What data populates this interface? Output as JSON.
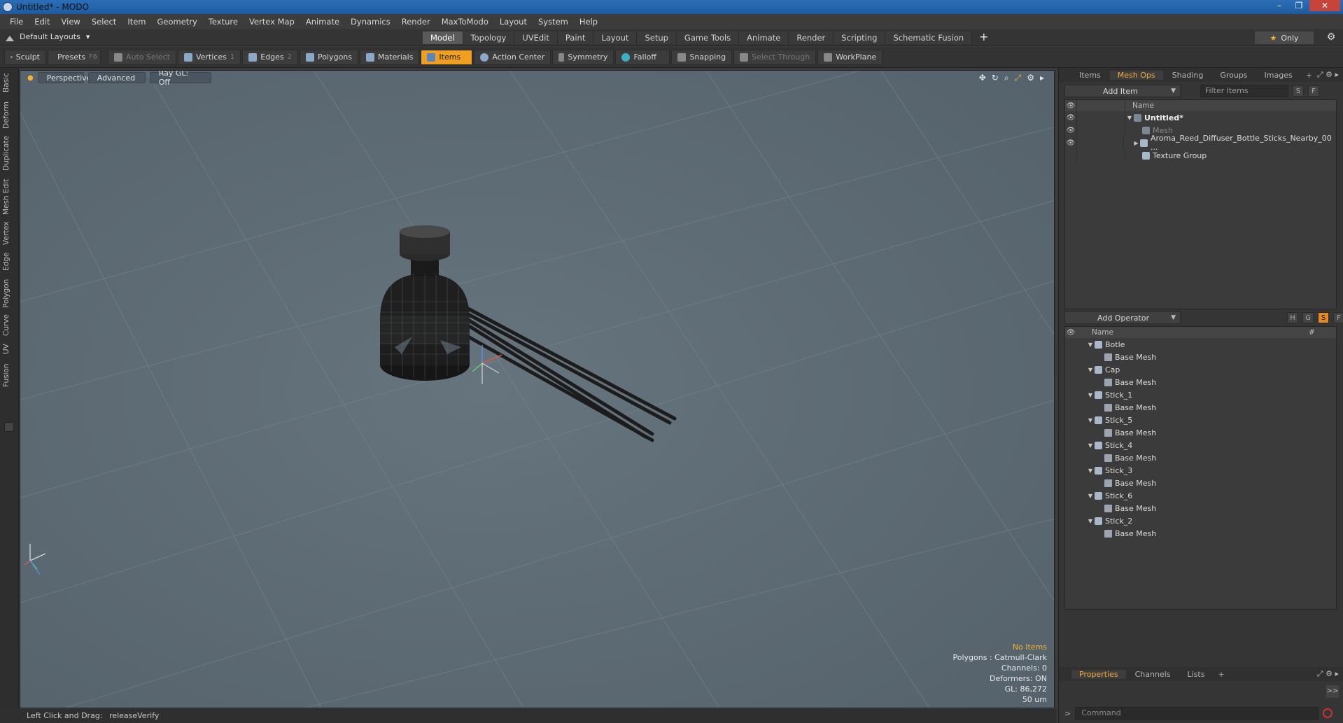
{
  "window": {
    "title": "Untitled* - MODO",
    "controls": [
      "–",
      "❐",
      "✕"
    ]
  },
  "menu": [
    "File",
    "Edit",
    "View",
    "Select",
    "Item",
    "Geometry",
    "Texture",
    "Vertex Map",
    "Animate",
    "Dynamics",
    "Render",
    "MaxToModo",
    "Layout",
    "System",
    "Help"
  ],
  "layout_selector": "Default Layouts",
  "mode_tabs": [
    "Model",
    "Topology",
    "UVEdit",
    "Paint",
    "Layout",
    "Setup",
    "Game Tools",
    "Animate",
    "Render",
    "Scripting",
    "Schematic Fusion"
  ],
  "only_label": "Only",
  "toolbar": {
    "sculpt": "Sculpt",
    "presets": "Presets",
    "presets_key": "F6",
    "auto_select": "Auto Select",
    "vertices": "Vertices",
    "vertices_key": "1",
    "edges": "Edges",
    "edges_key": "2",
    "polygons": "Polygons",
    "materials": "Materials",
    "items": "Items",
    "action_center": "Action Center",
    "symmetry": "Symmetry",
    "falloff": "Falloff",
    "snapping": "Snapping",
    "select_through": "Select Through",
    "workplane": "WorkPlane"
  },
  "left_tabs": [
    "Basic",
    "Deform",
    "Duplicate",
    "Mesh Edit",
    "Vertex",
    "Edge",
    "Polygon",
    "Curve",
    "UV",
    "Fusion"
  ],
  "viewport": {
    "view": "Perspective",
    "shading": "Advanced",
    "raygl": "Ray GL: Off",
    "info": {
      "items": "No Items",
      "polygons": "Polygons : Catmull-Clark",
      "channels": "Channels: 0",
      "deformers": "Deformers: ON",
      "gl": "GL: 86,272",
      "scale": "50 um"
    }
  },
  "status": {
    "hint": "Left Click and Drag:",
    "action": "releaseVerify"
  },
  "items_panel": {
    "tabs": [
      "Items",
      "Mesh Ops",
      "Shading",
      "Groups",
      "Images"
    ],
    "active_tab": "Mesh Ops",
    "add_item": "Add Item",
    "filter_placeholder": "Filter Items",
    "s": "S",
    "f": "F",
    "header_name": "Name",
    "rows": [
      {
        "label": "Untitled*"
      },
      {
        "label": "Mesh"
      },
      {
        "label": "Aroma_Reed_Diffuser_Bottle_Sticks_Nearby_00 ..."
      },
      {
        "label": "Texture Group"
      }
    ]
  },
  "ops_panel": {
    "add_operator": "Add Operator",
    "h": "H",
    "g": "G",
    "s": "S",
    "f": "F",
    "header_name": "Name",
    "header_hash": "#",
    "groups": [
      {
        "name": "Botle",
        "child": "Base Mesh"
      },
      {
        "name": "Cap",
        "child": "Base Mesh"
      },
      {
        "name": "Stick_1",
        "child": "Base Mesh"
      },
      {
        "name": "Stick_5",
        "child": "Base Mesh"
      },
      {
        "name": "Stick_4",
        "child": "Base Mesh"
      },
      {
        "name": "Stick_3",
        "child": "Base Mesh"
      },
      {
        "name": "Stick_6",
        "child": "Base Mesh"
      },
      {
        "name": "Stick_2",
        "child": "Base Mesh"
      }
    ]
  },
  "props_panel": {
    "tabs": [
      "Properties",
      "Channels",
      "Lists"
    ],
    "active_tab": "Properties",
    "expand": ">>"
  },
  "command": {
    "placeholder": "Command"
  }
}
